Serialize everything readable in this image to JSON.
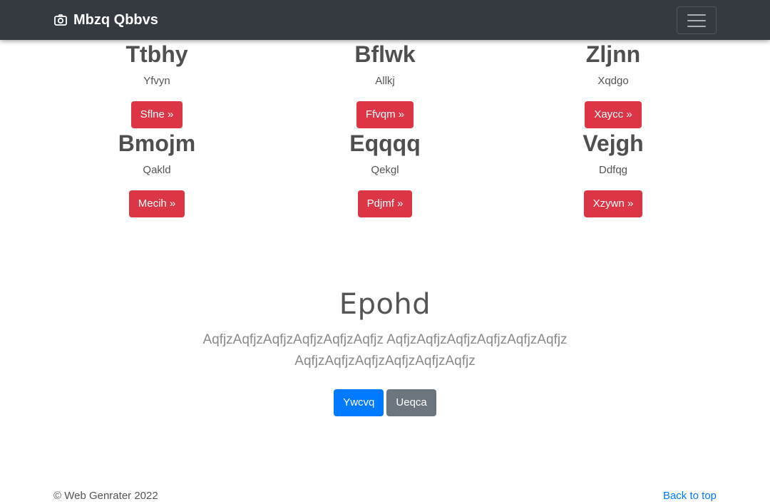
{
  "navbar": {
    "brand_icon": "camera-icon",
    "brand": "Mbzq Qbbvs",
    "toggler_icon": "hamburger-menu-icon"
  },
  "cards": [
    {
      "title": "Ttbhy",
      "text": "Yfvyn",
      "button": "Sflne »"
    },
    {
      "title": "Bflwk",
      "text": "Allkj",
      "button": "Ffvqm »"
    },
    {
      "title": "Zljnn",
      "text": "Xqdgo",
      "button": "Xaycc »"
    },
    {
      "title": "Bmojm",
      "text": "Qakld",
      "button": "Mecih »"
    },
    {
      "title": "Eqqqq",
      "text": "Qekgl",
      "button": "Pdjmf »"
    },
    {
      "title": "Vejgh",
      "text": "Ddfqg",
      "button": "Xzywn »"
    }
  ],
  "hero": {
    "title": "Epohd",
    "lead": "AqfjzAqfjzAqfjzAqfjzAqfjzAqfjz AqfjzAqfjzAqfjzAqfjzAqfjzAqfjz AqfjzAqfjzAqfjzAqfjzAqfjzAqfjz",
    "primary_button": "Ywcvq",
    "secondary_button": "Ueqca"
  },
  "footer": {
    "copyright": "© Web Genrater 2022",
    "back_to_top": "Back to top"
  },
  "colors": {
    "navbar_bg": "#343a40",
    "danger": "#dc3545",
    "primary": "#007bff",
    "secondary": "#6c757d"
  }
}
